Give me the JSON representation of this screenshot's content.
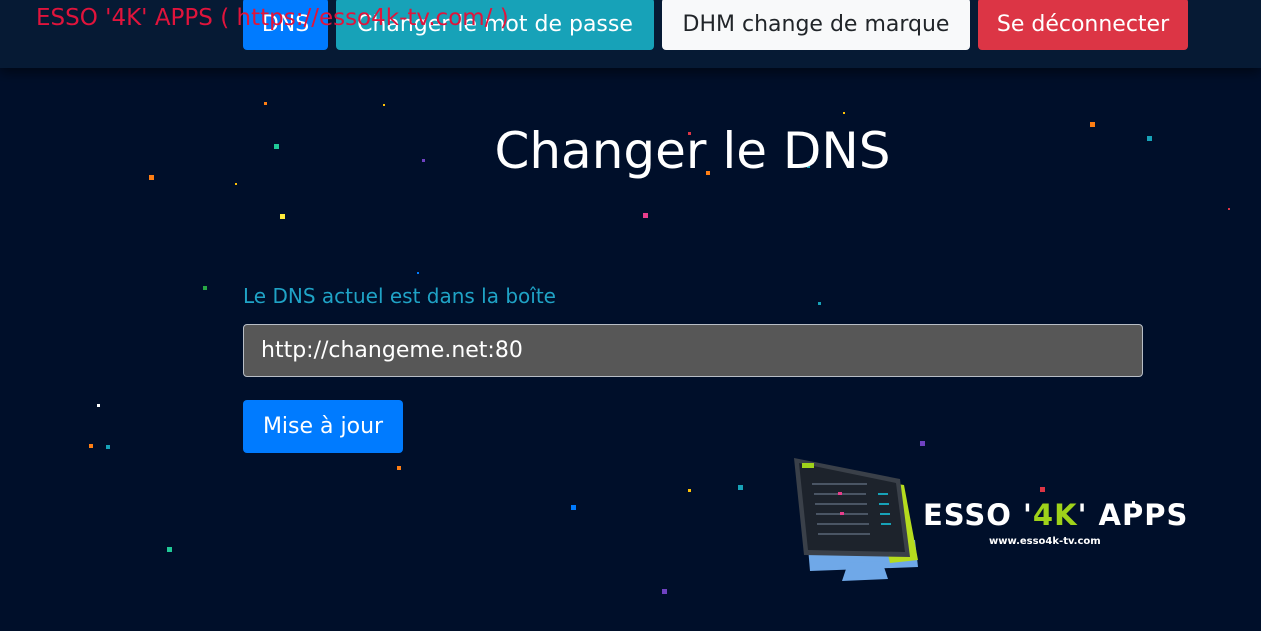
{
  "brand": {
    "name": "ESSO '4K' APPS (",
    "link": "https://esso4k-tv.com/",
    "close": ")"
  },
  "nav": {
    "dns": "DNS",
    "change_password": "Changer le mot de passe",
    "dhm": "DHM change de marque",
    "logout": "Se déconnecter"
  },
  "main": {
    "title": "Changer le DNS",
    "label": "Le DNS actuel est dans la boîte",
    "dns_value": "http://changeme.net:80",
    "update_label": "Mise à jour"
  },
  "logo": {
    "prefix": "ESSO '",
    "accent": "4K",
    "suffix": "' APPS",
    "url": "www.esso4k-tv.com"
  },
  "colors": {
    "background": "#000f2a",
    "topbar": "#061a34",
    "primary": "#007bff",
    "info": "#17a2b8",
    "light": "#f8f9fa",
    "danger": "#dc3545",
    "brand_red": "#e0143c",
    "label_teal": "#1fa3c6",
    "logo_green": "#9fd21a"
  }
}
